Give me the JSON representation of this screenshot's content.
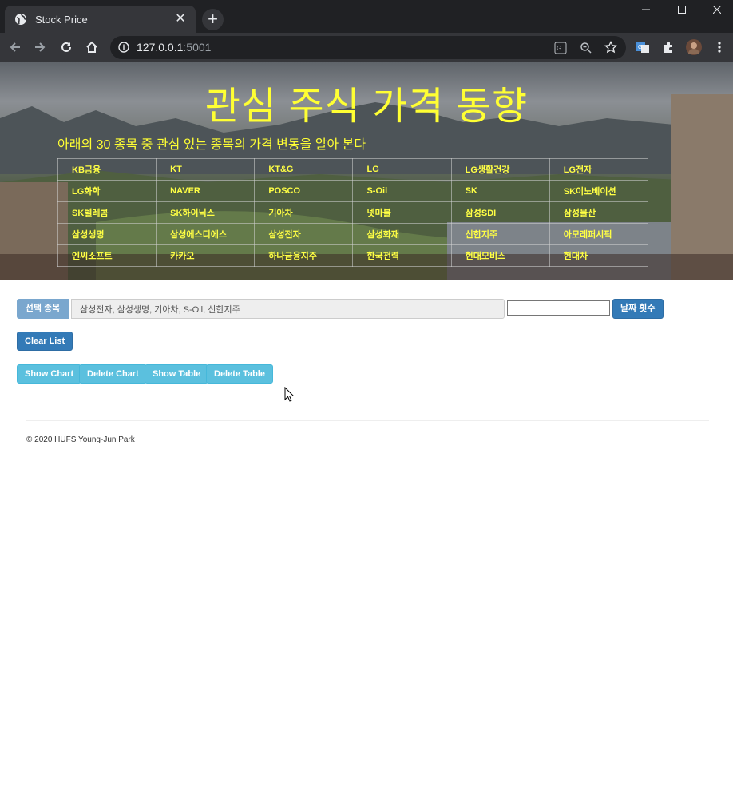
{
  "browser": {
    "tab_title": "Stock Price",
    "url_host": "127.0.0.1",
    "url_port": ":5001"
  },
  "hero": {
    "title": "관심 주식 가격 동향",
    "subtitle": "아래의 30 종목 중 관심 있는 종목의 가격 변동을 알아 본다",
    "stocks": [
      [
        "KB금융",
        "KT",
        "KT&G",
        "LG",
        "LG생활건강",
        "LG전자"
      ],
      [
        "LG화학",
        "NAVER",
        "POSCO",
        "S-Oil",
        "SK",
        "SK이노베이션"
      ],
      [
        "SK텔레콤",
        "SK하이닉스",
        "기아차",
        "넷마블",
        "삼성SDI",
        "삼성물산"
      ],
      [
        "삼성생명",
        "삼성에스디에스",
        "삼성전자",
        "삼성화재",
        "신한지주",
        "아모레퍼시픽"
      ],
      [
        "엔씨소프트",
        "카카오",
        "하나금융지주",
        "한국전력",
        "현대모비스",
        "현대차"
      ]
    ]
  },
  "form": {
    "addon_label": "선택 종목",
    "selected_value": "삼성전자, 삼성생명, 기아차, S-Oil, 신한지주",
    "date_count_value": "",
    "date_count_button": "날짜 횟수",
    "clear_button": "Clear List",
    "show_chart_button": "Show Chart",
    "delete_chart_button": "Delete Chart",
    "show_table_button": "Show Table",
    "delete_table_button": "Delete Table"
  },
  "footer": {
    "text": "© 2020 HUFS Young-Jun Park"
  },
  "colors": {
    "title_yellow": "#ffff33",
    "primary": "#337ab7",
    "info": "#5bc0de"
  }
}
